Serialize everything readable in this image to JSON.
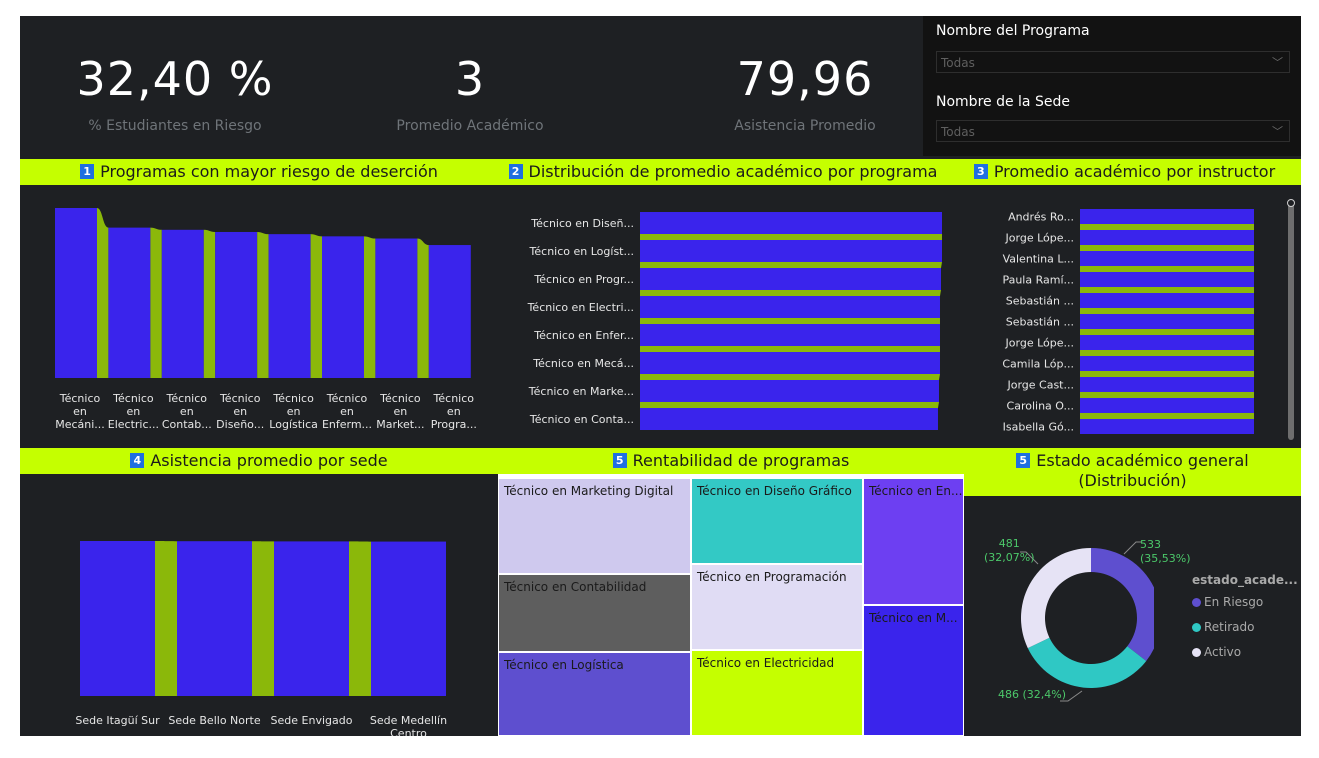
{
  "kpis": [
    {
      "value": "32,40 %",
      "label": "% Estudiantes en Riesgo"
    },
    {
      "value": "3",
      "label": "Promedio Académico"
    },
    {
      "value": "79,96",
      "label": "Asistencia Promedio"
    }
  ],
  "filters": {
    "programa": {
      "title": "Nombre del Programa",
      "value": "Todas"
    },
    "sede": {
      "title": "Nombre de la Sede",
      "value": "Todas"
    }
  },
  "sections": {
    "s1": {
      "num": "1",
      "title": "Programas con mayor riesgo de deserción"
    },
    "s2": {
      "num": "2",
      "title": "Distribución de promedio académico por programa"
    },
    "s3": {
      "num": "3",
      "title": "Promedio académico por instructor"
    },
    "s4": {
      "num": "4",
      "title": "Asistencia promedio por sede"
    },
    "s5": {
      "num": "5",
      "title": "Rentabilidad de programas"
    },
    "s6": {
      "num": "5",
      "title_line1": "Estado académico general",
      "title_line2": "(Distribución)"
    }
  },
  "colors": {
    "bar": "#3a24ec",
    "ribbon": "#8bb80a",
    "accent": "#c5ff00",
    "badge": "#1f6fe0"
  },
  "chart_data": [
    {
      "type": "bar",
      "categories": [
        [
          "Técnico",
          "en",
          "Mecáni..."
        ],
        [
          "Técnico",
          "en",
          "Electric..."
        ],
        [
          "Técnico",
          "en",
          "Contab..."
        ],
        [
          "Técnico",
          "en",
          "Diseño..."
        ],
        [
          "Técnico",
          "en",
          "Logística"
        ],
        [
          "Técnico",
          "en",
          "Enferm..."
        ],
        [
          "Técnico",
          "en",
          "Market..."
        ],
        [
          "Técnico",
          "en",
          "Progra..."
        ]
      ],
      "values": [
        0.39,
        0.345,
        0.34,
        0.335,
        0.33,
        0.325,
        0.32,
        0.305
      ],
      "ylim": [
        0,
        0.39
      ]
    },
    {
      "type": "bar",
      "orientation": "horizontal",
      "categories": [
        "Técnico en Diseñ...",
        "Técnico en Logíst...",
        "Técnico en Progr...",
        "Técnico en Electri...",
        "Técnico en Enfer...",
        "Técnico en Mecá...",
        "Técnico en Marke...",
        "Técnico en Conta..."
      ],
      "values": [
        3.01,
        3.01,
        3.0,
        2.99,
        2.99,
        2.99,
        2.98,
        2.97
      ],
      "xlim": [
        0,
        3.01
      ]
    },
    {
      "type": "bar",
      "orientation": "horizontal",
      "categories": [
        "Andrés Ro...",
        "Jorge Lópe...",
        "Valentina L...",
        "Paula Ramí...",
        "Sebastián ...",
        "Sebastián ...",
        "Jorge Lópe...",
        "Camila Lóp...",
        "Jorge Cast...",
        "Carolina O...",
        "Isabella Gó..."
      ],
      "values": [
        3.05,
        3.05,
        3.04,
        3.03,
        3.02,
        3.02,
        3.01,
        3.01,
        3.0,
        3.0,
        2.99
      ],
      "xlim": [
        0,
        3.05
      ]
    },
    {
      "type": "bar",
      "categories": [
        [
          "Sede Itagüí Sur"
        ],
        [
          "Sede Bello Norte"
        ],
        [
          "Sede Envigado"
        ],
        [
          "Sede Medellín",
          "Centro"
        ]
      ],
      "values": [
        80.1,
        80.0,
        79.9,
        79.8
      ],
      "ylim": [
        0,
        80.1
      ]
    },
    {
      "type": "treemap",
      "items": [
        {
          "label": "Técnico en Marketing Digital",
          "color": "#cfc9ee",
          "text": "#1a1a1a"
        },
        {
          "label": "Técnico en Contabilidad",
          "color": "#5e5e5e",
          "text": "#1a1a1a"
        },
        {
          "label": "Técnico en Logística",
          "color": "#5e4fcf",
          "text": "#1a1a1a"
        },
        {
          "label": "Técnico en Diseño Gráfico",
          "color": "#33c9c5",
          "text": "#1a1a1a"
        },
        {
          "label": "Técnico en Programación",
          "color": "#e0dcf4",
          "text": "#1a1a1a"
        },
        {
          "label": "Técnico en Electricidad",
          "color": "#c5ff00",
          "text": "#1a1a1a"
        },
        {
          "label": "Técnico en En...",
          "color": "#6d3ff2",
          "text": "#1a1a1a"
        },
        {
          "label": "Técnico en M...",
          "color": "#3a24ec",
          "text": "#1a1a1a"
        }
      ]
    },
    {
      "type": "pie",
      "donut": true,
      "legend_title": "estado_acade...",
      "slices": [
        {
          "name": "En Riesgo",
          "value": 533,
          "pct": "35,53%",
          "color": "#5e4fcf"
        },
        {
          "name": "Retirado",
          "value": 486,
          "pct": "32,4%",
          "color": "#2fc8c4"
        },
        {
          "name": "Activo",
          "value": 481,
          "pct": "32,07%",
          "color": "#e6e3f5"
        }
      ],
      "labels": {
        "a": "533",
        "a2": "(35,53%)",
        "b": "486 (32,4%)",
        "c": "481",
        "c2": "(32,07%)"
      }
    }
  ]
}
